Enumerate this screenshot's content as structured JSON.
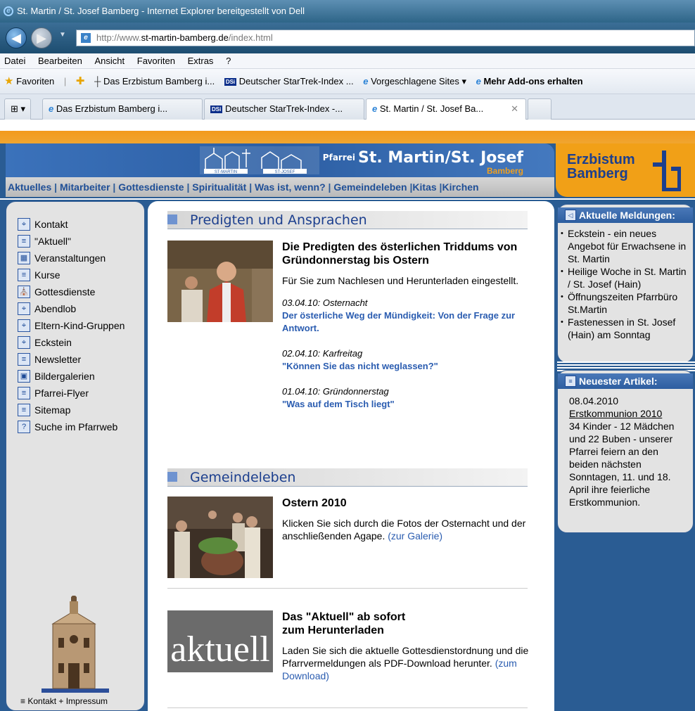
{
  "browser": {
    "title": "St. Martin / St. Josef Bamberg - Internet Explorer bereitgestellt von Dell",
    "address_prefix": "http://www.",
    "address_domain": "st-martin-bamberg.de",
    "address_path": "/index.html",
    "menu": [
      "Datei",
      "Bearbeiten",
      "Ansicht",
      "Favoriten",
      "Extras",
      "?"
    ],
    "favorites_label": "Favoriten",
    "fav_items": [
      "Das Erzbistum Bamberg i...",
      "Deutscher StarTrek-Index ...",
      "Vorgeschlagene Sites ▾",
      "Mehr Add-ons erhalten"
    ],
    "tabs": [
      "Das Erzbistum Bamberg i...",
      "Deutscher StarTrek-Index -...",
      "St. Martin / St. Josef Ba..."
    ],
    "dsi_label": "DSi"
  },
  "header": {
    "pfarrei_label": "Pfarrei",
    "pfarrei_name": "St. Martin/St. Josef",
    "bamberg_sub": "Bamberg",
    "erz_line1": "Erzbistum",
    "erz_line2": "Bamberg",
    "logo_label_left": "ST-MARTIN",
    "logo_label_right": "ST-JOSEF"
  },
  "nav": [
    "Aktuelles",
    "Mitarbeiter",
    "Gottesdienste",
    "Spiritualität",
    "Was ist, wenn?",
    "Gemeindeleben",
    "Kitas",
    "Kirchen"
  ],
  "sidebar": {
    "items": [
      {
        "label": "Kontakt",
        "icon": "map-icon"
      },
      {
        "label": "\"Aktuell\"",
        "icon": "document-icon"
      },
      {
        "label": "Veranstaltungen",
        "icon": "calendar-icon"
      },
      {
        "label": "Kurse",
        "icon": "document-icon"
      },
      {
        "label": "Gottesdienste",
        "icon": "church-icon"
      },
      {
        "label": "Abendlob",
        "icon": "map-icon"
      },
      {
        "label": "Eltern-Kind-Gruppen",
        "icon": "map-icon"
      },
      {
        "label": "Eckstein",
        "icon": "map-icon"
      },
      {
        "label": "Newsletter",
        "icon": "document-icon"
      },
      {
        "label": "Bildergalerien",
        "icon": "gallery-icon"
      },
      {
        "label": "Pfarrei-Flyer",
        "icon": "document-icon"
      },
      {
        "label": "Sitemap",
        "icon": "document-icon"
      },
      {
        "label": "Suche im Pfarrweb",
        "icon": "help-icon"
      }
    ],
    "impressum": "≡ Kontakt + Impressum"
  },
  "main": {
    "section1": "Predigten und Ansprachen",
    "art1_title": "Die Predigten des österlichen Triddums von Gründonnerstag bis Ostern",
    "art1_text": "Für Sie zum Nachlesen und Herunterladen eingestellt.",
    "sermons": [
      {
        "date": "03.04.10: Osternacht",
        "title": "Der österliche Weg der Mündigkeit: Von der Frage zur Antwort."
      },
      {
        "date": "02.04.10: Karfreitag",
        "title": "\"Können Sie das nicht weglassen?\""
      },
      {
        "date": "01.04.10: Gründonnerstag",
        "title": "\"Was auf dem Tisch liegt\""
      }
    ],
    "section2": "Gemeindeleben",
    "art2_title": "Ostern 2010",
    "art2_text": "Klicken Sie sich durch die Fotos der Osternacht und der anschließenden Agape.",
    "art2_link": "(zur Galerie)",
    "art3_title_l1": "Das \"Aktuell\" ab sofort",
    "art3_title_l2": "zum Herunterladen",
    "art3_text": "Laden Sie sich die aktuelle Gottesdienstordnung und die Pfarrvermeldungen als PDF-Download herunter.",
    "art3_link": "(zum Download)",
    "aktuell_logo": "aktuell"
  },
  "right": {
    "news_title": "Aktuelle Meldungen:",
    "news": [
      "Eckstein - ein neues Angebot für Erwachsene in St. Martin",
      "Heilige Woche in St. Martin / St. Josef (Hain)",
      "Öffnungszeiten Pfarrbüro St.Martin",
      "Fastenessen in St. Josef (Hain) am Sonntag"
    ],
    "article_title": "Neuester Artikel:",
    "article_date": "08.04.2010",
    "article_link": "Erstkommunion 2010",
    "article_text": "34 Kinder - 12 Mädchen und 22 Buben - unserer Pfarrei feiern an den beiden nächsten Sonntagen, 11. und 18. April ihre feierliche Erstkommunion."
  }
}
